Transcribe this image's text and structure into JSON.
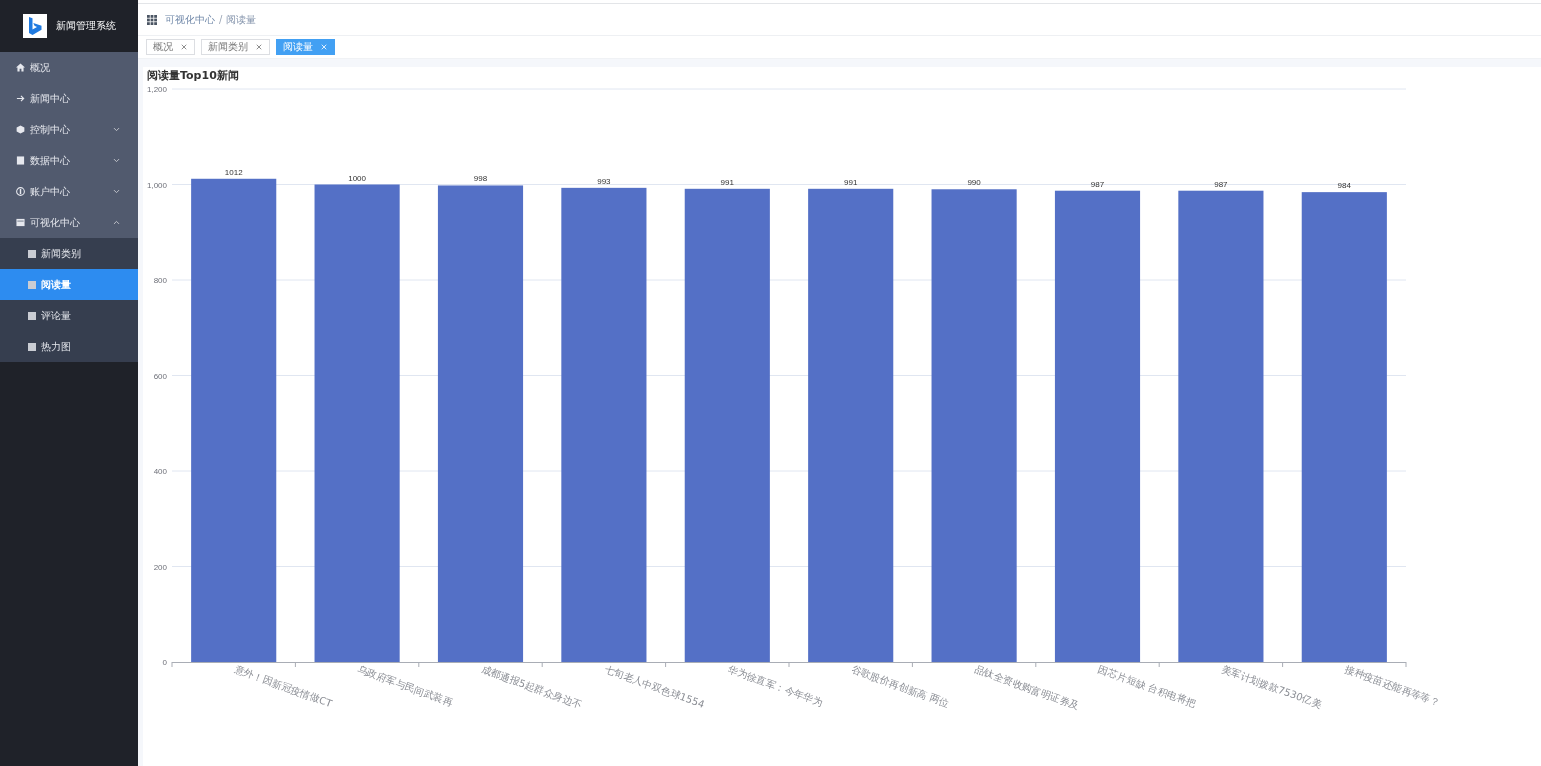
{
  "sidebar": {
    "title": "新闻管理系统",
    "items": [
      {
        "kind": "link",
        "label": "概况",
        "selected": false
      },
      {
        "kind": "link",
        "label": "新闻中心",
        "selected": false
      },
      {
        "kind": "submenu",
        "label": "控制中心",
        "selected": false,
        "expanded": false
      },
      {
        "kind": "submenu",
        "label": "数据中心",
        "selected": false,
        "expanded": false
      },
      {
        "kind": "submenu",
        "label": "账户中心",
        "selected": false,
        "expanded": false
      },
      {
        "kind": "submenu",
        "label": "可视化中心",
        "selected": false,
        "expanded": true,
        "children": [
          {
            "label": "新闻类别",
            "selected": false
          },
          {
            "label": "阅读量",
            "selected": true
          },
          {
            "label": "评论量",
            "selected": false
          },
          {
            "label": "热力图",
            "selected": false
          }
        ]
      }
    ]
  },
  "breadcrumb": {
    "items": [
      "可视化中心",
      "阅读量"
    ],
    "separator": "/"
  },
  "tabs": [
    {
      "label": "概况",
      "selected": false
    },
    {
      "label": "新闻类别",
      "selected": false
    },
    {
      "label": "阅读量",
      "selected": true
    }
  ],
  "chart": {
    "chart_data": {
      "type": "bar",
      "title": "阅读量Top10新闻",
      "categories": [
        "意外！因新冠疫情做CT",
        "乌政府军与民间武装再",
        "成都通报5起群众身边不",
        "七旬老人中双色球1554",
        "华为徐直军：今年华为",
        "谷歌股价再创新高 两位",
        "品钛全资收购富明证券及",
        "因芯片短缺 台积电将把",
        "美军计划拨款7530亿美",
        "接种疫苗还能再等等？"
      ],
      "values": [
        1012,
        1000,
        998,
        993,
        991,
        991,
        990,
        987,
        987,
        984
      ],
      "ylim": [
        0,
        1200
      ],
      "yticks": [
        0,
        200,
        400,
        600,
        800,
        {
          "value": 1000,
          "label": "1,000"
        },
        {
          "value": 1200,
          "label": "1,200"
        }
      ],
      "grid": true,
      "data_labels": true,
      "color": "#5470c6"
    }
  }
}
